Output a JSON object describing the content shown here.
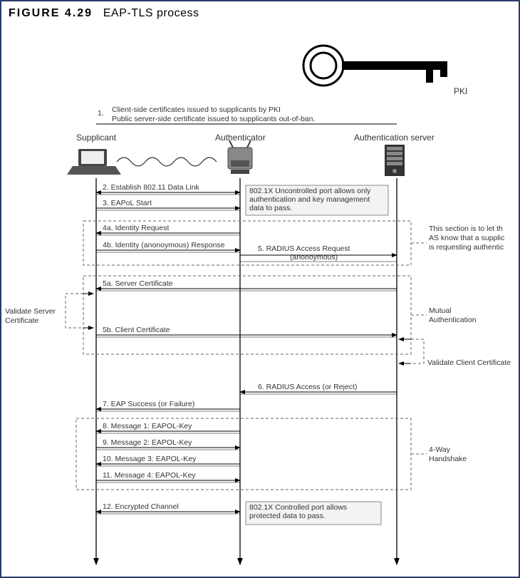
{
  "figure_label": "FIGURE 4.29",
  "figure_title": "EAP-TLS process",
  "pki_label": "PKI",
  "step1_num": "1.",
  "step1_line1": "Client-side certificates issued to supplicants by PKI",
  "step1_line2": "Public server-side certificate issued to supplicants out-of-ban.",
  "actors": {
    "supplicant": "Supplicant",
    "authenticator": "Authenticator",
    "authserver": "Authentication server"
  },
  "messages": {
    "m2": "2. Establish 802.11 Data Link",
    "m3": "3. EAPoL Start",
    "m4a": "4a. Identity Request",
    "m4b": "4b. Identity (anonoymous) Response",
    "m5": "5. RADIUS Access Request",
    "m5sub": "(anonoymous)",
    "m5a": "5a. Server Certificate",
    "m5b": "5b. Client Certificate",
    "m6": "6. RADIUS Access (or Reject)",
    "m7": "7. EAP Success (or Failure)",
    "m8": "8. Message 1: EAPOL-Key",
    "m9": "9. Message 2: EAPOL-Key",
    "m10": "10. Message 3: EAPOL-Key",
    "m11": "11. Message 4: EAPOL-Key",
    "m12": "12. Encrypted Channel"
  },
  "notes": {
    "uncontrolled_port": "802.1X Uncontrolled port allows only authentication and key management data to pass.",
    "controlled_port": "802.1X Controlled port allows protected data to pass.",
    "validate_server": "Validate Server Certificate",
    "validate_client": "Validate Client Certificate",
    "mutual_auth": "Mutual Authentication",
    "four_way": "4-Way Handshake",
    "identity_section_l1": "This section is to let th",
    "identity_section_l2": "AS know that a supplic",
    "identity_section_l3": "is requesting authentic"
  }
}
